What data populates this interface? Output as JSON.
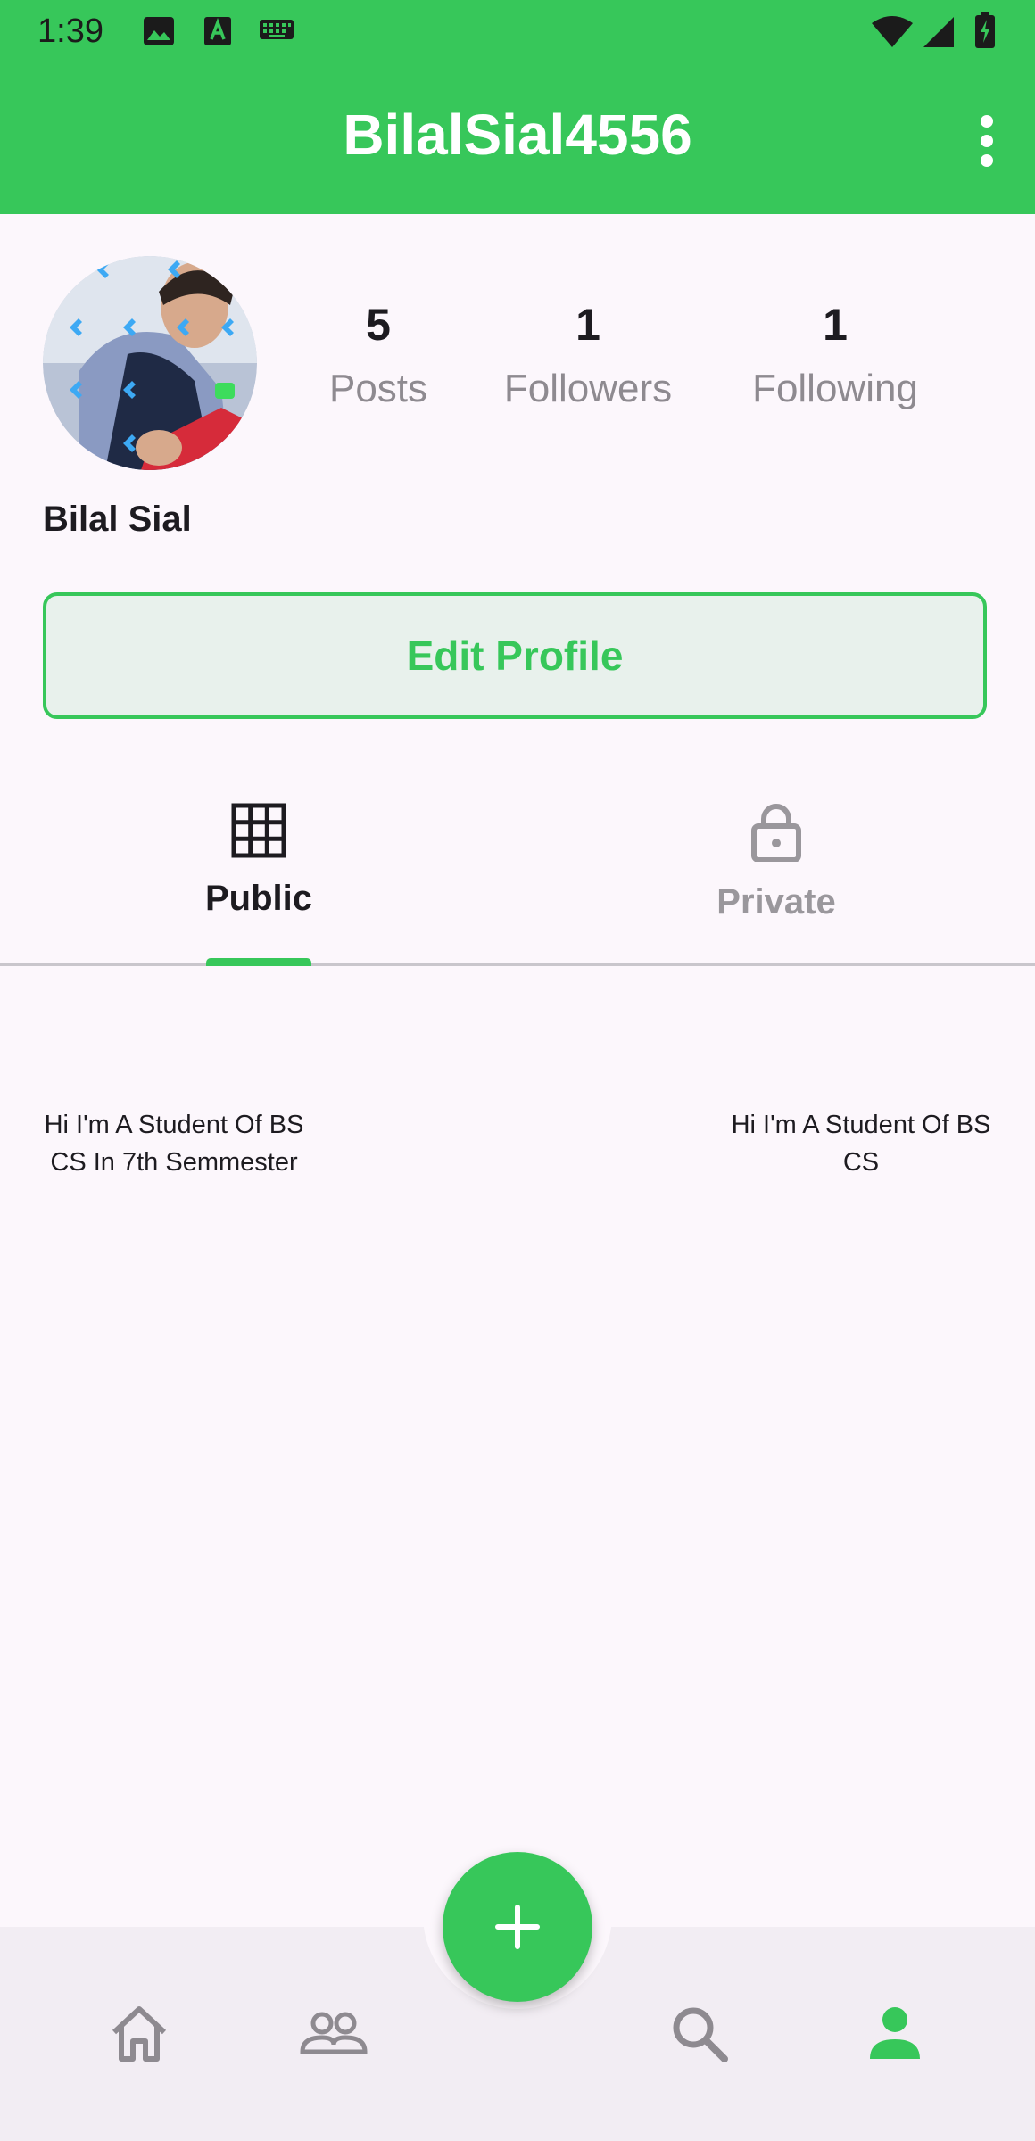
{
  "status_bar": {
    "time": "1:39",
    "icons": [
      "image-icon",
      "a-notification-icon",
      "keyboard-icon",
      "wifi-icon",
      "signal-icon",
      "battery-charging-icon"
    ]
  },
  "app_bar": {
    "title": "BilalSial4556",
    "menu_icon": "more-vert-icon"
  },
  "profile": {
    "name": "Bilal Sial",
    "stats": [
      {
        "count": "5",
        "label": "Posts"
      },
      {
        "count": "1",
        "label": "Followers"
      },
      {
        "count": "1",
        "label": "Following"
      }
    ],
    "edit_button_label": "Edit Profile"
  },
  "tabs": [
    {
      "label": "Public",
      "icon": "grid-icon",
      "selected": true
    },
    {
      "label": "Private",
      "icon": "lock-icon",
      "selected": false
    }
  ],
  "posts": [
    {
      "text": "Hi I'm A Student Of BS CS In 7th Semmester"
    },
    {
      "text": "Hi I'm A Student Of BS CS"
    }
  ],
  "bottom_nav": {
    "items": [
      {
        "icon": "home-icon",
        "active": false
      },
      {
        "icon": "people-icon",
        "active": false
      },
      {
        "icon": "search-icon",
        "active": false
      },
      {
        "icon": "person-icon",
        "active": true
      }
    ],
    "fab_icon": "add-icon"
  },
  "colors": {
    "accent": "#37C75A",
    "background": "#FCF7FC",
    "nav_background": "#F2EDF3",
    "inactive": "#9A979C",
    "text": "#1D1B20"
  }
}
